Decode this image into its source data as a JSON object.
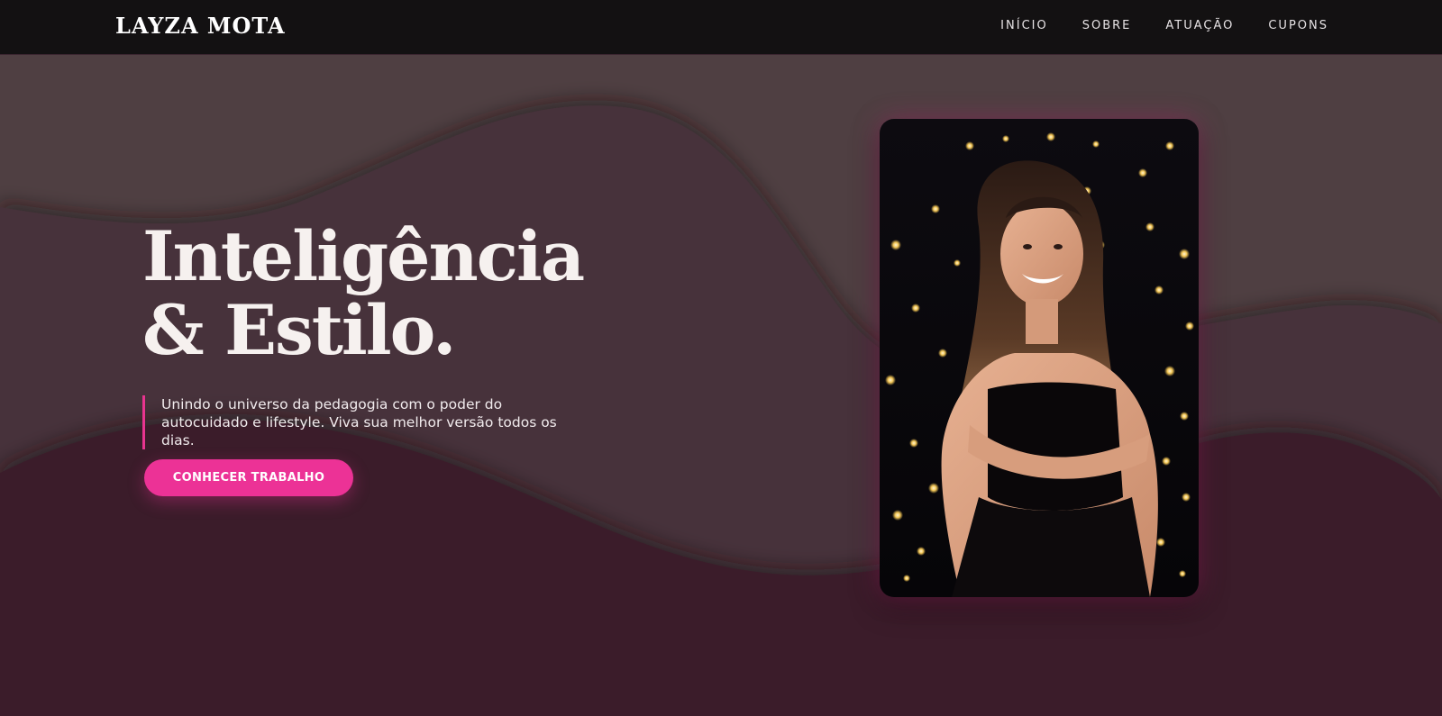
{
  "header": {
    "logo": "LAYZA MOTA",
    "nav": [
      {
        "label": "INÍCIO"
      },
      {
        "label": "SOBRE"
      },
      {
        "label": "ATUAÇÃO"
      },
      {
        "label": "CUPONS"
      }
    ]
  },
  "hero": {
    "title_line1": "Inteligência",
    "title_line2": "& Estilo.",
    "description": "Unindo o universo da pedagogia com o poder do autocuidado e lifestyle. Viva sua melhor versão todos os dias.",
    "cta_label": "CONHECER TRABALHO",
    "photo_alt": "Foto de Layza Mota sorrindo com vestido preto e fundo de luzes"
  },
  "colors": {
    "navbar_bg": "#131112",
    "accent_pink": "#ec3296",
    "bg_top": "#4f3f42",
    "bg_mid": "#46313a",
    "bg_bottom": "#3a1f2a",
    "text_light": "#f6f1ef"
  }
}
